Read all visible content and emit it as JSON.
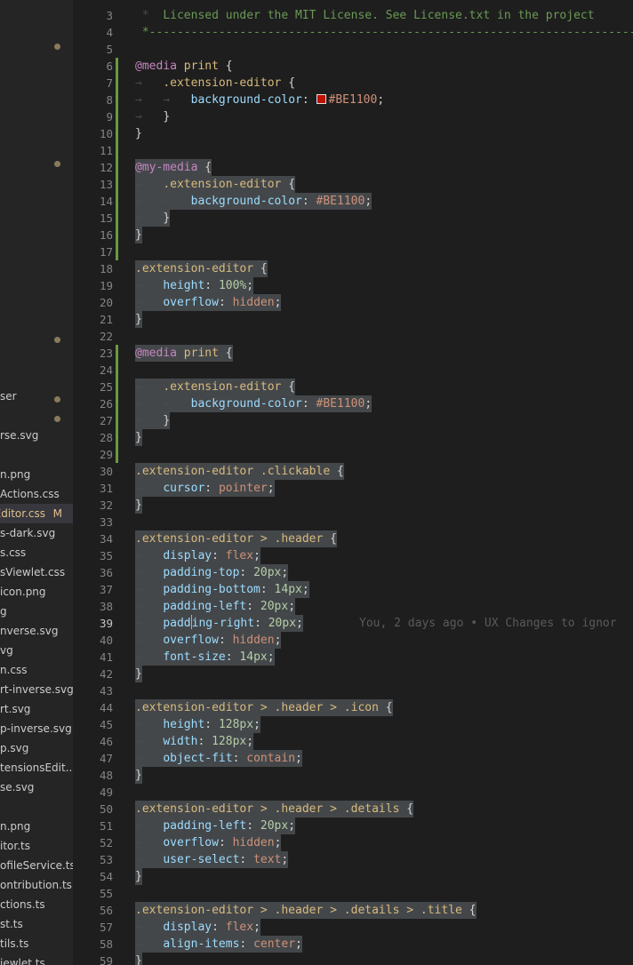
{
  "explorer": {
    "files": [
      {
        "name": "ser",
        "badge": "",
        "modified": false,
        "active": false
      },
      {
        "name": "rse.svg",
        "badge": "",
        "modified": false,
        "active": false
      },
      {
        "name": "n.png",
        "badge": "",
        "modified": false,
        "active": false
      },
      {
        "name": "Actions.css",
        "badge": "",
        "modified": false,
        "active": false
      },
      {
        "name": "Editor.css",
        "badge": "M",
        "modified": true,
        "active": true
      },
      {
        "name": "s-dark.svg",
        "badge": "",
        "modified": false,
        "active": false
      },
      {
        "name": "s.css",
        "badge": "",
        "modified": false,
        "active": false
      },
      {
        "name": "sViewlet.css",
        "badge": "",
        "modified": false,
        "active": false
      },
      {
        "name": "icon.png",
        "badge": "",
        "modified": false,
        "active": false
      },
      {
        "name": "g",
        "badge": "",
        "modified": false,
        "active": false
      },
      {
        "name": "nverse.svg",
        "badge": "",
        "modified": false,
        "active": false
      },
      {
        "name": "vg",
        "badge": "",
        "modified": false,
        "active": false
      },
      {
        "name": "n.css",
        "badge": "",
        "modified": false,
        "active": false
      },
      {
        "name": "rt-inverse.svg",
        "badge": "",
        "modified": false,
        "active": false
      },
      {
        "name": "rt.svg",
        "badge": "",
        "modified": false,
        "active": false
      },
      {
        "name": "p-inverse.svg",
        "badge": "",
        "modified": false,
        "active": false
      },
      {
        "name": "p.svg",
        "badge": "",
        "modified": false,
        "active": false
      },
      {
        "name": "tensionsEdit...",
        "badge": "",
        "modified": false,
        "active": false
      },
      {
        "name": "se.svg",
        "badge": "",
        "modified": false,
        "active": false
      },
      {
        "name": "n.png",
        "badge": "",
        "modified": false,
        "active": false
      },
      {
        "name": "itor.ts",
        "badge": "",
        "modified": false,
        "active": false
      },
      {
        "name": "ofileService.ts",
        "badge": "",
        "modified": false,
        "active": false
      },
      {
        "name": "ontribution.ts",
        "badge": "",
        "modified": false,
        "active": false
      },
      {
        "name": "ctions.ts",
        "badge": "",
        "modified": false,
        "active": false
      },
      {
        "name": "st.ts",
        "badge": "",
        "modified": false,
        "active": false
      },
      {
        "name": "tils.ts",
        "badge": "",
        "modified": false,
        "active": false
      },
      {
        "name": "iewlet.ts",
        "badge": "",
        "modified": false,
        "active": false
      }
    ]
  },
  "editor": {
    "cursor_line": 39,
    "blame_text": "You, 2 days ago • UX Changes to ignor",
    "lines": [
      {
        "n": 3,
        "mod": false,
        "hl": false,
        "t": [
          [
            "ind",
            " *  "
          ],
          [
            "com",
            "Licensed under the MIT License. See License.txt in the project"
          ]
        ]
      },
      {
        "n": 4,
        "mod": false,
        "hl": false,
        "t": [
          [
            "com",
            " *--------------------------------------------------------------------------"
          ]
        ]
      },
      {
        "n": 5,
        "mod": false,
        "hl": false,
        "t": []
      },
      {
        "n": 6,
        "mod": true,
        "hl": false,
        "t": [
          [
            "at",
            "@media"
          ],
          [
            "p",
            " "
          ],
          [
            "sel",
            "print"
          ],
          [
            "p",
            " {"
          ]
        ]
      },
      {
        "n": 7,
        "mod": true,
        "hl": false,
        "t": [
          [
            "ind",
            "→   "
          ],
          [
            "sel",
            ".extension-editor"
          ],
          [
            "p",
            " {"
          ]
        ]
      },
      {
        "n": 8,
        "mod": true,
        "hl": false,
        "swatch": true,
        "t": [
          [
            "ind",
            "→   →   "
          ],
          [
            "prop",
            "background-color"
          ],
          [
            "p",
            ": "
          ],
          [
            "sw",
            ""
          ],
          [
            "val",
            "#BE1100"
          ],
          [
            "p",
            ";"
          ]
        ]
      },
      {
        "n": 9,
        "mod": true,
        "hl": false,
        "t": [
          [
            "ind",
            "→   "
          ],
          [
            "p",
            "}"
          ]
        ]
      },
      {
        "n": 10,
        "mod": true,
        "hl": false,
        "t": [
          [
            "p",
            "}"
          ]
        ]
      },
      {
        "n": 11,
        "mod": true,
        "hl": false,
        "t": []
      },
      {
        "n": 12,
        "mod": true,
        "hl": true,
        "t": [
          [
            "at",
            "@my-media"
          ],
          [
            "p",
            " {"
          ]
        ]
      },
      {
        "n": 13,
        "mod": true,
        "hl": true,
        "t": [
          [
            "ind",
            "→   "
          ],
          [
            "sel",
            ".extension-editor"
          ],
          [
            "p",
            " {"
          ]
        ]
      },
      {
        "n": 14,
        "mod": true,
        "hl": true,
        "t": [
          [
            "ind",
            "→   →   "
          ],
          [
            "prop",
            "background-color"
          ],
          [
            "p",
            ": "
          ],
          [
            "val",
            "#BE1100"
          ],
          [
            "p",
            ";"
          ]
        ]
      },
      {
        "n": 15,
        "mod": true,
        "hl": true,
        "t": [
          [
            "ind",
            "→   "
          ],
          [
            "p",
            "}"
          ]
        ]
      },
      {
        "n": 16,
        "mod": true,
        "hl": true,
        "t": [
          [
            "p",
            "}"
          ]
        ]
      },
      {
        "n": 17,
        "mod": true,
        "hl": false,
        "t": []
      },
      {
        "n": 18,
        "mod": false,
        "hl": true,
        "t": [
          [
            "sel",
            ".extension-editor"
          ],
          [
            "p",
            " {"
          ]
        ]
      },
      {
        "n": 19,
        "mod": false,
        "hl": true,
        "t": [
          [
            "ind",
            "→   "
          ],
          [
            "prop",
            "height"
          ],
          [
            "p",
            ": "
          ],
          [
            "num",
            "100%"
          ],
          [
            "p",
            ";"
          ]
        ]
      },
      {
        "n": 20,
        "mod": false,
        "hl": true,
        "t": [
          [
            "ind",
            "→   "
          ],
          [
            "prop",
            "overflow"
          ],
          [
            "p",
            ": "
          ],
          [
            "val",
            "hidden"
          ],
          [
            "p",
            ";"
          ]
        ]
      },
      {
        "n": 21,
        "mod": false,
        "hl": true,
        "t": [
          [
            "p",
            "}"
          ]
        ]
      },
      {
        "n": 22,
        "mod": false,
        "hl": false,
        "t": []
      },
      {
        "n": 23,
        "mod": true,
        "hl": true,
        "t": [
          [
            "at",
            "@media"
          ],
          [
            "p",
            " "
          ],
          [
            "sel",
            "print"
          ],
          [
            "p",
            " {"
          ]
        ]
      },
      {
        "n": 24,
        "mod": true,
        "hl": false,
        "t": []
      },
      {
        "n": 25,
        "mod": true,
        "hl": true,
        "t": [
          [
            "ind",
            "→   "
          ],
          [
            "sel",
            ".extension-editor"
          ],
          [
            "p",
            " {"
          ]
        ]
      },
      {
        "n": 26,
        "mod": true,
        "hl": true,
        "t": [
          [
            "ind",
            "→   →   "
          ],
          [
            "prop",
            "background-color"
          ],
          [
            "p",
            ": "
          ],
          [
            "val",
            "#BE1100"
          ],
          [
            "p",
            ";"
          ]
        ]
      },
      {
        "n": 27,
        "mod": true,
        "hl": true,
        "t": [
          [
            "ind",
            "→   "
          ],
          [
            "p",
            "}"
          ]
        ]
      },
      {
        "n": 28,
        "mod": true,
        "hl": true,
        "t": [
          [
            "p",
            "}"
          ]
        ]
      },
      {
        "n": 29,
        "mod": true,
        "hl": false,
        "t": []
      },
      {
        "n": 30,
        "mod": false,
        "hl": true,
        "t": [
          [
            "sel",
            ".extension-editor .clickable"
          ],
          [
            "p",
            " {"
          ]
        ]
      },
      {
        "n": 31,
        "mod": false,
        "hl": true,
        "t": [
          [
            "ind",
            "→   "
          ],
          [
            "prop",
            "cursor"
          ],
          [
            "p",
            ": "
          ],
          [
            "val",
            "pointer"
          ],
          [
            "p",
            ";"
          ]
        ]
      },
      {
        "n": 32,
        "mod": false,
        "hl": true,
        "t": [
          [
            "p",
            "}"
          ]
        ]
      },
      {
        "n": 33,
        "mod": false,
        "hl": false,
        "t": []
      },
      {
        "n": 34,
        "mod": false,
        "hl": true,
        "t": [
          [
            "sel",
            ".extension-editor > .header"
          ],
          [
            "p",
            " {"
          ]
        ]
      },
      {
        "n": 35,
        "mod": false,
        "hl": true,
        "t": [
          [
            "ind",
            "→   "
          ],
          [
            "prop",
            "display"
          ],
          [
            "p",
            ": "
          ],
          [
            "val",
            "flex"
          ],
          [
            "p",
            ";"
          ]
        ]
      },
      {
        "n": 36,
        "mod": false,
        "hl": true,
        "t": [
          [
            "ind",
            "→   "
          ],
          [
            "prop",
            "padding-top"
          ],
          [
            "p",
            ": "
          ],
          [
            "num",
            "20px"
          ],
          [
            "p",
            ";"
          ]
        ]
      },
      {
        "n": 37,
        "mod": false,
        "hl": true,
        "t": [
          [
            "ind",
            "→   "
          ],
          [
            "prop",
            "padding-bottom"
          ],
          [
            "p",
            ": "
          ],
          [
            "num",
            "14px"
          ],
          [
            "p",
            ";"
          ]
        ]
      },
      {
        "n": 38,
        "mod": false,
        "hl": true,
        "t": [
          [
            "ind",
            "→   "
          ],
          [
            "prop",
            "padding-left"
          ],
          [
            "p",
            ": "
          ],
          [
            "num",
            "20px"
          ],
          [
            "p",
            ";"
          ]
        ]
      },
      {
        "n": 39,
        "mod": false,
        "hl": true,
        "blame": true,
        "t": [
          [
            "ind",
            "→   "
          ],
          [
            "prop",
            "padd"
          ],
          [
            "caret",
            ""
          ],
          [
            "prop",
            "ing-right"
          ],
          [
            "p",
            ": "
          ],
          [
            "num",
            "20px"
          ],
          [
            "p",
            ";"
          ]
        ]
      },
      {
        "n": 40,
        "mod": false,
        "hl": true,
        "t": [
          [
            "ind",
            "→   "
          ],
          [
            "prop",
            "overflow"
          ],
          [
            "p",
            ": "
          ],
          [
            "val",
            "hidden"
          ],
          [
            "p",
            ";"
          ]
        ]
      },
      {
        "n": 41,
        "mod": false,
        "hl": true,
        "t": [
          [
            "ind",
            "→   "
          ],
          [
            "prop",
            "font-size"
          ],
          [
            "p",
            ": "
          ],
          [
            "num",
            "14px"
          ],
          [
            "p",
            ";"
          ]
        ]
      },
      {
        "n": 42,
        "mod": false,
        "hl": true,
        "t": [
          [
            "p",
            "}"
          ]
        ]
      },
      {
        "n": 43,
        "mod": false,
        "hl": false,
        "t": []
      },
      {
        "n": 44,
        "mod": false,
        "hl": true,
        "t": [
          [
            "sel",
            ".extension-editor > .header > .icon"
          ],
          [
            "p",
            " {"
          ]
        ]
      },
      {
        "n": 45,
        "mod": false,
        "hl": true,
        "t": [
          [
            "ind",
            "→   "
          ],
          [
            "prop",
            "height"
          ],
          [
            "p",
            ": "
          ],
          [
            "num",
            "128px"
          ],
          [
            "p",
            ";"
          ]
        ]
      },
      {
        "n": 46,
        "mod": false,
        "hl": true,
        "t": [
          [
            "ind",
            "→   "
          ],
          [
            "prop",
            "width"
          ],
          [
            "p",
            ": "
          ],
          [
            "num",
            "128px"
          ],
          [
            "p",
            ";"
          ]
        ]
      },
      {
        "n": 47,
        "mod": false,
        "hl": true,
        "t": [
          [
            "ind",
            "→   "
          ],
          [
            "prop",
            "object-fit"
          ],
          [
            "p",
            ": "
          ],
          [
            "val",
            "contain"
          ],
          [
            "p",
            ";"
          ]
        ]
      },
      {
        "n": 48,
        "mod": false,
        "hl": true,
        "t": [
          [
            "p",
            "}"
          ]
        ]
      },
      {
        "n": 49,
        "mod": false,
        "hl": false,
        "t": []
      },
      {
        "n": 50,
        "mod": false,
        "hl": true,
        "t": [
          [
            "sel",
            ".extension-editor > .header > .details"
          ],
          [
            "p",
            " {"
          ]
        ]
      },
      {
        "n": 51,
        "mod": false,
        "hl": true,
        "t": [
          [
            "ind",
            "→   "
          ],
          [
            "prop",
            "padding-left"
          ],
          [
            "p",
            ": "
          ],
          [
            "num",
            "20px"
          ],
          [
            "p",
            ";"
          ]
        ]
      },
      {
        "n": 52,
        "mod": false,
        "hl": true,
        "t": [
          [
            "ind",
            "→   "
          ],
          [
            "prop",
            "overflow"
          ],
          [
            "p",
            ": "
          ],
          [
            "val",
            "hidden"
          ],
          [
            "p",
            ";"
          ]
        ]
      },
      {
        "n": 53,
        "mod": false,
        "hl": true,
        "t": [
          [
            "ind",
            "→   "
          ],
          [
            "prop",
            "user-select"
          ],
          [
            "p",
            ": "
          ],
          [
            "val",
            "text"
          ],
          [
            "p",
            ";"
          ]
        ]
      },
      {
        "n": 54,
        "mod": false,
        "hl": true,
        "t": [
          [
            "p",
            "}"
          ]
        ]
      },
      {
        "n": 55,
        "mod": false,
        "hl": false,
        "t": []
      },
      {
        "n": 56,
        "mod": false,
        "hl": true,
        "t": [
          [
            "sel",
            ".extension-editor > .header > .details > .title"
          ],
          [
            "p",
            " {"
          ]
        ]
      },
      {
        "n": 57,
        "mod": false,
        "hl": true,
        "t": [
          [
            "ind",
            "→   "
          ],
          [
            "prop",
            "display"
          ],
          [
            "p",
            ": "
          ],
          [
            "val",
            "flex"
          ],
          [
            "p",
            ";"
          ]
        ]
      },
      {
        "n": 58,
        "mod": false,
        "hl": true,
        "t": [
          [
            "ind",
            "→   "
          ],
          [
            "prop",
            "align-items"
          ],
          [
            "p",
            ": "
          ],
          [
            "val",
            "center"
          ],
          [
            "p",
            ";"
          ]
        ]
      },
      {
        "n": 59,
        "mod": false,
        "hl": true,
        "t": [
          [
            "p",
            "}"
          ]
        ]
      },
      {
        "n": 60,
        "mod": false,
        "hl": false,
        "t": []
      }
    ]
  }
}
